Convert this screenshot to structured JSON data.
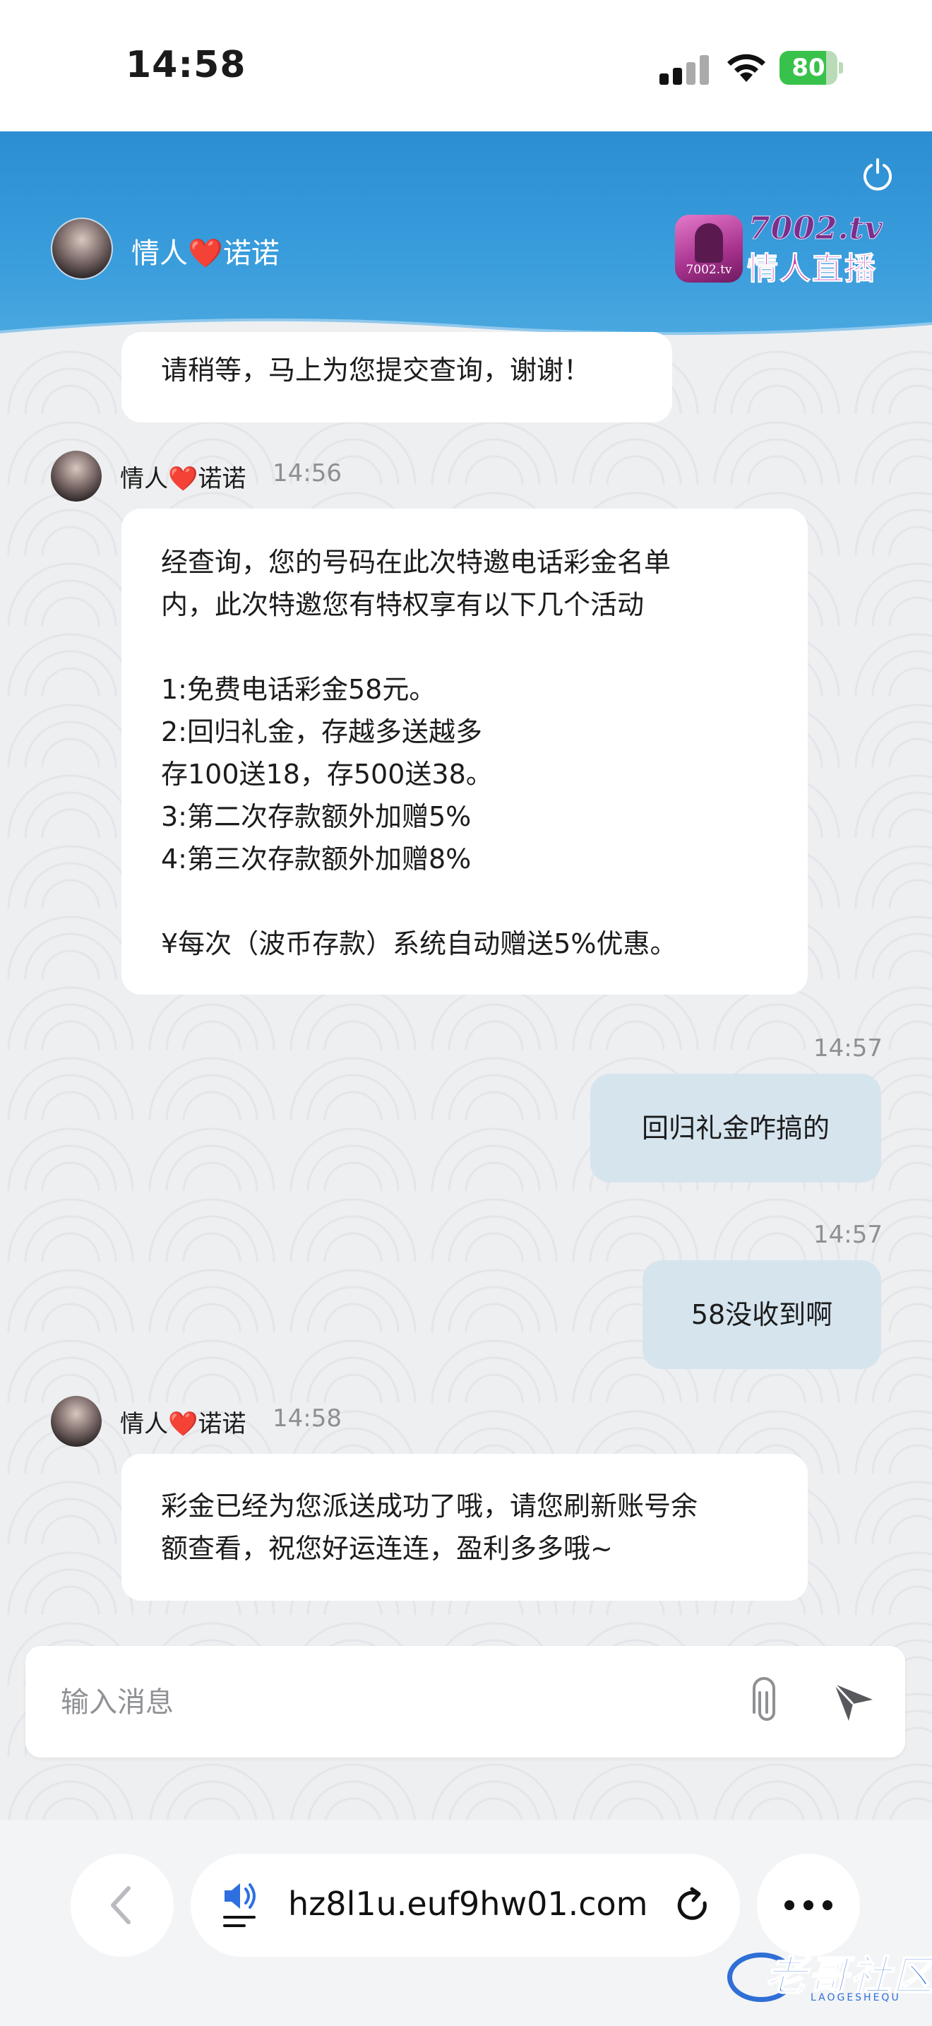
{
  "status_bar": {
    "time": "14:58",
    "battery_level": "80",
    "battery_fraction": 0.8
  },
  "header": {
    "name_prefix": "情人",
    "name_heart": "❤️",
    "name_suffix": "诺诺",
    "brand_domain": "7002.tv",
    "brand_name": "情人直播",
    "brand_logo_text": "7002.tv",
    "power_icon": "power-icon"
  },
  "messages": [
    {
      "direction": "in",
      "lines": [
        "请稍等，马上为您提交查询，谢谢！"
      ]
    },
    {
      "direction": "in",
      "sender_prefix": "情人",
      "sender_heart": "❤️",
      "sender_suffix": "诺诺",
      "time": "14:56",
      "lines": [
        "经查询，您的号码在此次特邀电话彩金名单",
        "内，此次特邀您有特权享有以下几个活动",
        "",
        "1:免费电话彩金58元。",
        "2:回归礼金，存越多送越多",
        "存100送18，存500送38。",
        "3:第二次存款额外加赠5%",
        "4:第三次存款额外加赠8%",
        "",
        "¥每次（波币存款）系统自动赠送5%优惠。"
      ]
    },
    {
      "direction": "out",
      "time": "14:57",
      "text": "回归礼金咋搞的"
    },
    {
      "direction": "out",
      "time": "14:57",
      "text": "58没收到啊"
    },
    {
      "direction": "in",
      "sender_prefix": "情人",
      "sender_heart": "❤️",
      "sender_suffix": "诺诺",
      "time": "14:58",
      "lines": [
        "彩金已经为您派送成功了哦，请您刷新账号余",
        "额查看，祝您好运连连，盈利多多哦~"
      ]
    }
  ],
  "composer": {
    "placeholder": "输入消息",
    "attach_icon": "paperclip-icon",
    "send_icon": "send-icon"
  },
  "browser": {
    "url": "hz8l1u.euf9hw01.com",
    "back_icon": "chevron-left-icon",
    "speaker_icon": "speaker-icon",
    "reload_icon": "reload-icon",
    "more_icon": "more-icon"
  },
  "watermark": {
    "text": "老哥社区",
    "sub": "LAOGESHEQU"
  },
  "colors": {
    "header_blue": "#2b8ed2",
    "outgoing_bubble": "#d6e4ee",
    "incoming_bubble": "#ffffff",
    "heart_red": "#ea2a2a",
    "battery_green": "#39c24b"
  }
}
